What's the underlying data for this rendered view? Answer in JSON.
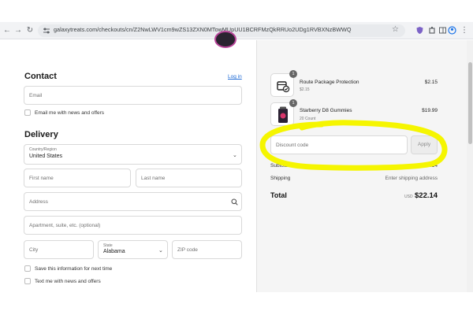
{
  "browser": {
    "url": "galaxytreats.com/checkouts/cn/Z2NwLWV1cm9wZS13ZXN0MTowMUpUU1BCRFMzQkRRUo2UDg1RVBXNzBWWQ",
    "back_icon": "arrow-left-icon",
    "forward_icon": "arrow-right-icon",
    "reload_icon": "reload-icon"
  },
  "contact": {
    "heading": "Contact",
    "login_link": "Log in",
    "email_placeholder": "Email",
    "email_offers_label": "Email me with news and offers"
  },
  "delivery": {
    "heading": "Delivery",
    "country_label": "Country/Region",
    "country_value": "United States",
    "first_name_placeholder": "First name",
    "last_name_placeholder": "Last name",
    "address_placeholder": "Address",
    "apartment_placeholder": "Apartment, suite, etc. (optional)",
    "city_placeholder": "City",
    "state_label": "State",
    "state_value": "Alabama",
    "zip_placeholder": "ZIP code",
    "save_info_label": "Save this information for next time",
    "text_offers_label": "Text me with news and offers"
  },
  "order": {
    "items": [
      {
        "name": "Route Package Protection",
        "sub": "$2.15",
        "price": "$2.15",
        "qty": "1"
      },
      {
        "name": "Starberry D8 Gummies",
        "sub": "20 Count",
        "price": "$19.99",
        "qty": "1"
      }
    ],
    "discount_placeholder": "Discount code",
    "apply_label": "Apply",
    "subtotal_label": "Subtotal · 2 items",
    "subtotal_value": "$22.14",
    "shipping_label": "Shipping",
    "shipping_value": "Enter shipping address",
    "total_label": "Total",
    "currency": "USD",
    "total_value": "$22.14"
  },
  "colors": {
    "annotation": "#f5f500",
    "link": "#1f6bd6"
  }
}
